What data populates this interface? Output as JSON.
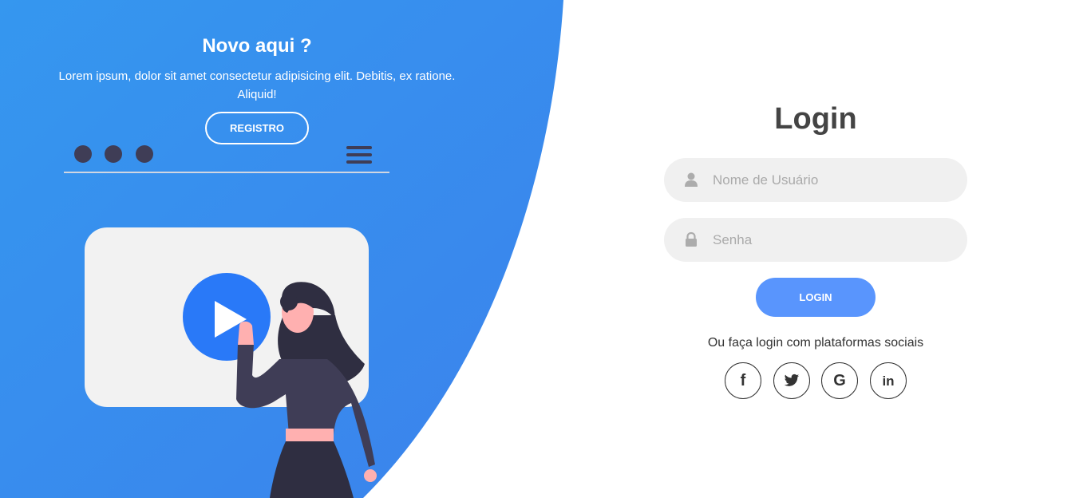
{
  "left_panel": {
    "title": "Novo aqui ?",
    "text": "Lorem ipsum, dolor sit amet consectetur adipisicing elit. Debitis, ex ratione. Aliquid!",
    "register_label": "REGISTRO"
  },
  "login_form": {
    "title": "Login",
    "username_placeholder": "Nome de Usuário",
    "username_value": "",
    "password_placeholder": "Senha",
    "password_value": "",
    "login_label": "LOGIN",
    "social_text": "Ou faça login com plataformas sociais",
    "social": [
      {
        "icon": "facebook-icon",
        "glyph": "f"
      },
      {
        "icon": "twitter-icon",
        "glyph": ""
      },
      {
        "icon": "google-icon",
        "glyph": "G"
      },
      {
        "icon": "linkedin-icon",
        "glyph": "in"
      }
    ]
  },
  "colors": {
    "panel_blue": "#3596f0",
    "button_blue": "#5995fd",
    "play_blue": "#2979f8",
    "field_bg": "#f0f0f0",
    "dark": "#2f2e41"
  }
}
